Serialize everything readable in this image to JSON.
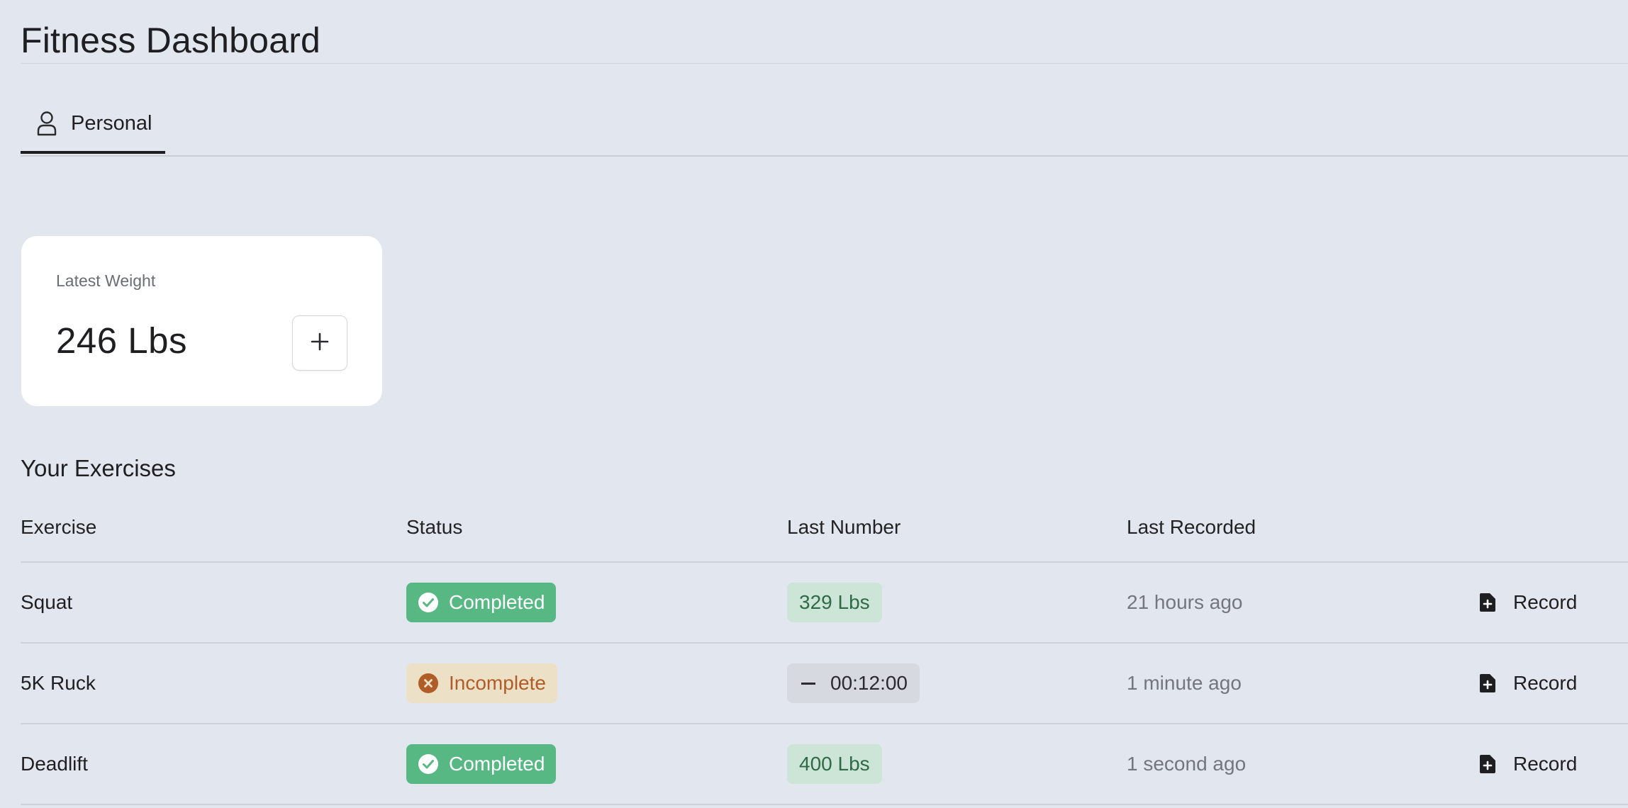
{
  "header": {
    "title": "Fitness Dashboard"
  },
  "tabs": [
    {
      "label": "Personal",
      "icon": "user-icon",
      "active": true
    }
  ],
  "weight_card": {
    "label": "Latest Weight",
    "value": "246 Lbs",
    "add_icon": "plus-icon"
  },
  "exercises": {
    "title": "Your Exercises",
    "columns": [
      "Exercise",
      "Status",
      "Last Number",
      "Last Recorded"
    ],
    "rows": [
      {
        "name": "Squat",
        "status": "Completed",
        "status_icon": "check-circle-icon",
        "last_number": "329 Lbs",
        "last_recorded": "21 hours ago",
        "action": "Record"
      },
      {
        "name": "5K Ruck",
        "status": "Incomplete",
        "status_icon": "x-circle-icon",
        "last_number": "00:12:00",
        "last_recorded": "1 minute ago",
        "action": "Record"
      },
      {
        "name": "Deadlift",
        "status": "Completed",
        "status_icon": "check-circle-icon",
        "last_number": "400 Lbs",
        "last_recorded": "1 second ago",
        "action": "Record"
      }
    ]
  },
  "colors": {
    "background": "#e2e6ee",
    "completed": "#57b884",
    "incomplete_bg": "#ece1c7",
    "incomplete_text": "#b05c27",
    "number_green_bg": "#cce5d7"
  }
}
